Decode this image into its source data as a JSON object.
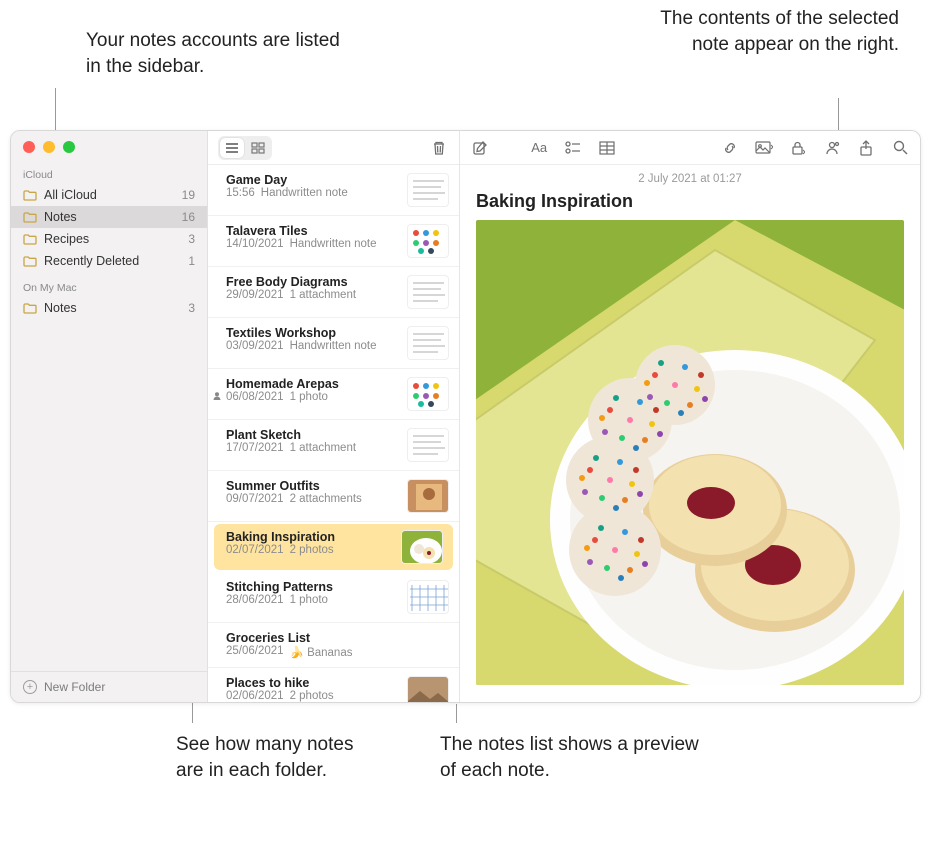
{
  "callouts": {
    "top_left": "Your notes accounts are listed in the sidebar.",
    "top_right": "The contents of the selected note appear on the right.",
    "bottom_left": "See how many notes are in each folder.",
    "bottom_right": "The notes list shows a preview of each note."
  },
  "sidebar": {
    "sections": [
      {
        "header": "iCloud",
        "items": [
          {
            "label": "All iCloud",
            "count": "19",
            "selected": false
          },
          {
            "label": "Notes",
            "count": "16",
            "selected": true
          },
          {
            "label": "Recipes",
            "count": "3",
            "selected": false
          },
          {
            "label": "Recently Deleted",
            "count": "1",
            "selected": false
          }
        ]
      },
      {
        "header": "On My Mac",
        "items": [
          {
            "label": "Notes",
            "count": "3",
            "selected": false
          }
        ]
      }
    ],
    "footer": "New Folder"
  },
  "notesList": {
    "items": [
      {
        "title": "Game Day",
        "date": "15:56",
        "preview": "Handwritten note",
        "thumb": "lines",
        "shared": false
      },
      {
        "title": "Talavera Tiles",
        "date": "14/10/2021",
        "preview": "Handwritten note",
        "thumb": "dots",
        "shared": false
      },
      {
        "title": "Free Body Diagrams",
        "date": "29/09/2021",
        "preview": "1 attachment",
        "thumb": "lines",
        "shared": false
      },
      {
        "title": "Textiles Workshop",
        "date": "03/09/2021",
        "preview": "Handwritten note",
        "thumb": "lines",
        "shared": false
      },
      {
        "title": "Homemade Arepas",
        "date": "06/08/2021",
        "preview": "1 photo",
        "thumb": "dots",
        "shared": true
      },
      {
        "title": "Plant Sketch",
        "date": "17/07/2021",
        "preview": "1 attachment",
        "thumb": "lines",
        "shared": false
      },
      {
        "title": "Summer Outfits",
        "date": "09/07/2021",
        "preview": "2 attachments",
        "thumb": "photo1",
        "shared": false
      },
      {
        "title": "Baking Inspiration",
        "date": "02/07/2021",
        "preview": "2 photos",
        "thumb": "baking",
        "shared": false,
        "selected": true,
        "selColor": "#ffe4a0"
      },
      {
        "title": "Stitching Patterns",
        "date": "28/06/2021",
        "preview": "1 photo",
        "thumb": "grid",
        "shared": false
      },
      {
        "title": "Groceries List",
        "date": "25/06/2021",
        "preview": "🍌 Bananas",
        "thumb": "none",
        "shared": false
      },
      {
        "title": "Places to hike",
        "date": "02/06/2021",
        "preview": "2 photos",
        "thumb": "photo2",
        "shared": false
      }
    ]
  },
  "content": {
    "date": "2 July 2021 at 01:27",
    "title": "Baking Inspiration"
  },
  "icons": {
    "folder_color": "#c9a646"
  }
}
